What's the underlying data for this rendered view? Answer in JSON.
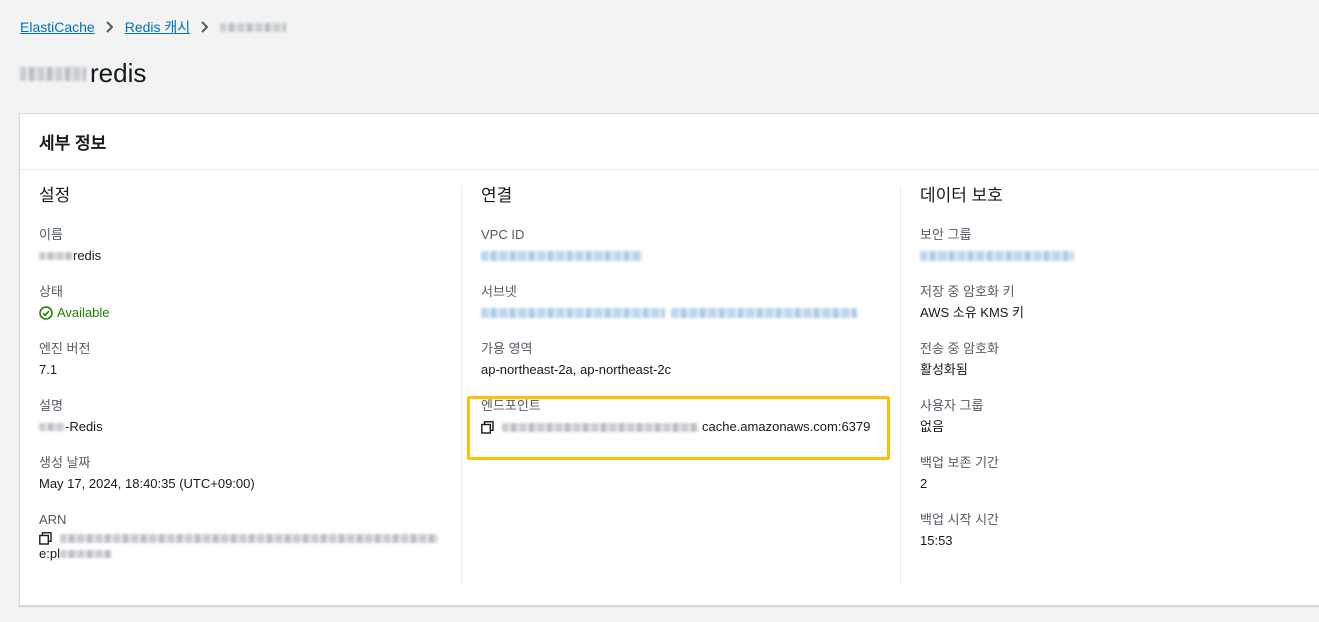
{
  "breadcrumb": {
    "items": [
      "ElastiCache",
      "Redis 캐시"
    ]
  },
  "page": {
    "title_suffix": "redis"
  },
  "panel": {
    "title": "세부 정보",
    "settings": {
      "title": "설정",
      "name_label": "이름",
      "name_value_suffix": "redis",
      "status_label": "상태",
      "status_value": "Available",
      "engine_version_label": "엔진 버전",
      "engine_version_value": "7.1",
      "description_label": "설명",
      "description_value_suffix": "-Redis",
      "created_label": "생성 날짜",
      "created_value": "May 17, 2024, 18:40:35 (UTC+09:00)",
      "arn_label": "ARN",
      "arn_value_prefix": "e:pl"
    },
    "connection": {
      "title": "연결",
      "vpc_label": "VPC ID",
      "subnet_label": "서브넷",
      "az_label": "가용 영역",
      "az_value": "ap-northeast-2a, ap-northeast-2c",
      "endpoint_label": "엔드포인트",
      "endpoint_value_suffix": "cache.amazonaws.com:6379"
    },
    "data_protection": {
      "title": "데이터 보호",
      "sg_label": "보안 그룹",
      "at_rest_label": "저장 중 암호화 키",
      "at_rest_value": "AWS 소유 KMS 키",
      "in_transit_label": "전송 중 암호화",
      "in_transit_value": "활성화됨",
      "user_group_label": "사용자 그룹",
      "user_group_value": "없음",
      "backup_retention_label": "백업 보존 기간",
      "backup_retention_value": "2",
      "backup_start_label": "백업 시작 시간",
      "backup_start_value": "15:53"
    }
  },
  "colors": {
    "link": "#0073bb",
    "success": "#1d8102",
    "highlight": "#ffc107"
  }
}
